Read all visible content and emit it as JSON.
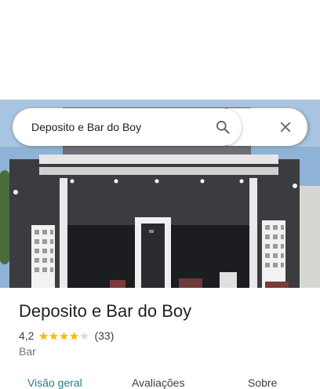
{
  "search": {
    "query": "Deposito e Bar do Boy",
    "search_icon": "search-icon",
    "close_icon": "close-icon"
  },
  "photo": {
    "alt": "storefront-photo"
  },
  "place": {
    "name": "Deposito e Bar do Boy",
    "rating": "4,2",
    "rating_stars": 4.2,
    "review_count": "(33)",
    "category": "Bar",
    "star_color": "#fbbc04",
    "empty_star_color": "#dadce0"
  },
  "tabs": [
    {
      "label": "Visão geral",
      "active": true
    },
    {
      "label": "Avaliações",
      "active": false
    },
    {
      "label": "Sobre",
      "active": false
    }
  ]
}
